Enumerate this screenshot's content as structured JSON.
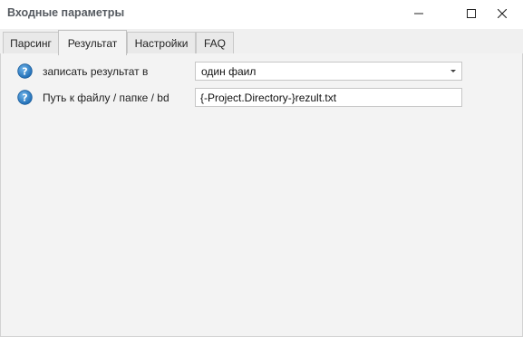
{
  "window": {
    "title": "Входные параметры"
  },
  "tabs": [
    {
      "label": "Парсинг",
      "active": false
    },
    {
      "label": "Результат",
      "active": true
    },
    {
      "label": "Настройки",
      "active": false
    },
    {
      "label": "FAQ",
      "active": false
    }
  ],
  "form": {
    "save_result": {
      "label": "записать результат в",
      "value": "один фаил"
    },
    "path": {
      "label": "Путь к файлу / папке / bd",
      "value": "{-Project.Directory-}rezult.txt"
    }
  },
  "icons": {
    "help": "question-circle-icon",
    "minimize": "minimize-icon",
    "maximize": "maximize-icon",
    "close": "close-icon"
  },
  "colors": {
    "help_icon_fill": "#2f7fc6",
    "content_bg": "#f3f3f3",
    "tab_bg": "#e9e9e9"
  }
}
